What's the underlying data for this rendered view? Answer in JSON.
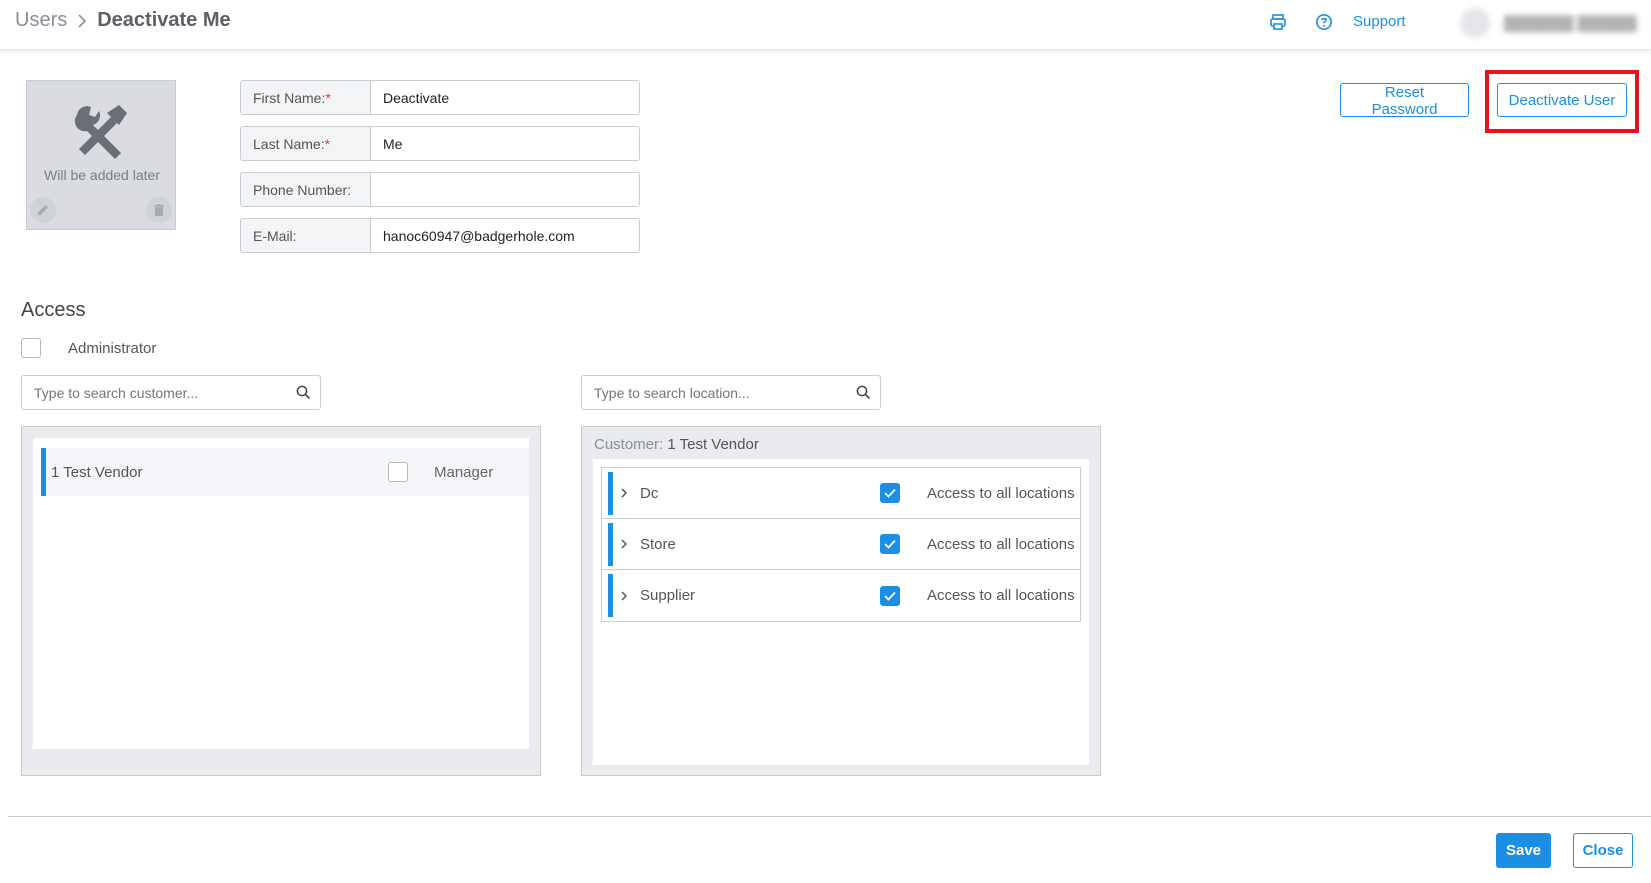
{
  "header": {
    "breadcrumb_parent": "Users",
    "breadcrumb_current": "Deactivate Me",
    "print_icon": "printer-icon",
    "help_icon": "help-circle-icon",
    "support_label": "Support"
  },
  "profile": {
    "avatar_placeholder": "Will be added later",
    "fields": {
      "first_name": {
        "label": "First Name:",
        "value": "Deactivate",
        "required": true
      },
      "last_name": {
        "label": "Last Name:",
        "value": "Me",
        "required": true
      },
      "phone": {
        "label": "Phone Number:",
        "value": ""
      },
      "email": {
        "label": "E-Mail:",
        "value": "hanoc60947@badgerhole.com"
      }
    },
    "required_mark": "*"
  },
  "actions": {
    "reset_password": "Reset Password",
    "deactivate_user": "Deactivate User"
  },
  "access": {
    "title": "Access",
    "administrator_label": "Administrator",
    "administrator_checked": false,
    "customer_search_placeholder": "Type to search customer...",
    "location_search_placeholder": "Type to search location...",
    "customers": [
      {
        "name": "1 Test Vendor",
        "manager_label": "Manager",
        "manager_checked": false
      }
    ],
    "location_panel": {
      "customer_prefix": "Customer:",
      "customer_name": "1 Test Vendor",
      "locations": [
        {
          "name": "Dc",
          "access_label": "Access to all locations",
          "checked": true
        },
        {
          "name": "Store",
          "access_label": "Access to all locations",
          "checked": true
        },
        {
          "name": "Supplier",
          "access_label": "Access to all locations",
          "checked": true
        }
      ]
    }
  },
  "footer": {
    "save_label": "Save",
    "close_label": "Close"
  },
  "colors": {
    "accent": "#1a8fe3",
    "highlight": "#e5141a"
  }
}
